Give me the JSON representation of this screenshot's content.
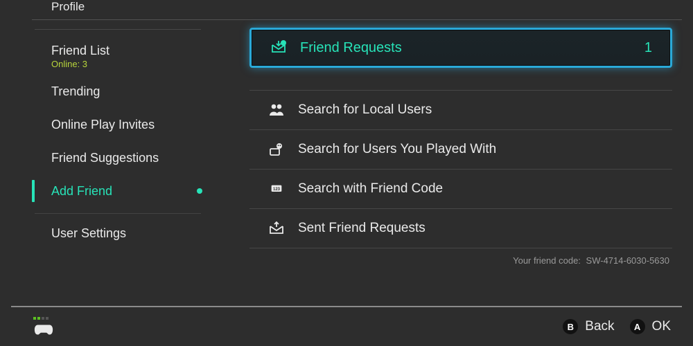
{
  "sidebar": {
    "profile": "Profile",
    "friendList": "Friend List",
    "onlineLabel": "Online: 3",
    "trending": "Trending",
    "onlinePlay": "Online Play Invites",
    "friendSuggestions": "Friend Suggestions",
    "addFriend": "Add Friend",
    "userSettings": "User Settings"
  },
  "main": {
    "friendRequests": {
      "label": "Friend Requests",
      "count": "1"
    },
    "searchLocal": "Search for Local Users",
    "searchPlayed": "Search for Users You Played With",
    "searchCode": "Search with Friend Code",
    "sentRequests": "Sent Friend Requests",
    "friendCodeLabel": "Your friend code:",
    "friendCodeValue": "SW-4714-6030-5630"
  },
  "footer": {
    "back": "Back",
    "ok": "OK",
    "bGlyph": "B",
    "aGlyph": "A"
  }
}
